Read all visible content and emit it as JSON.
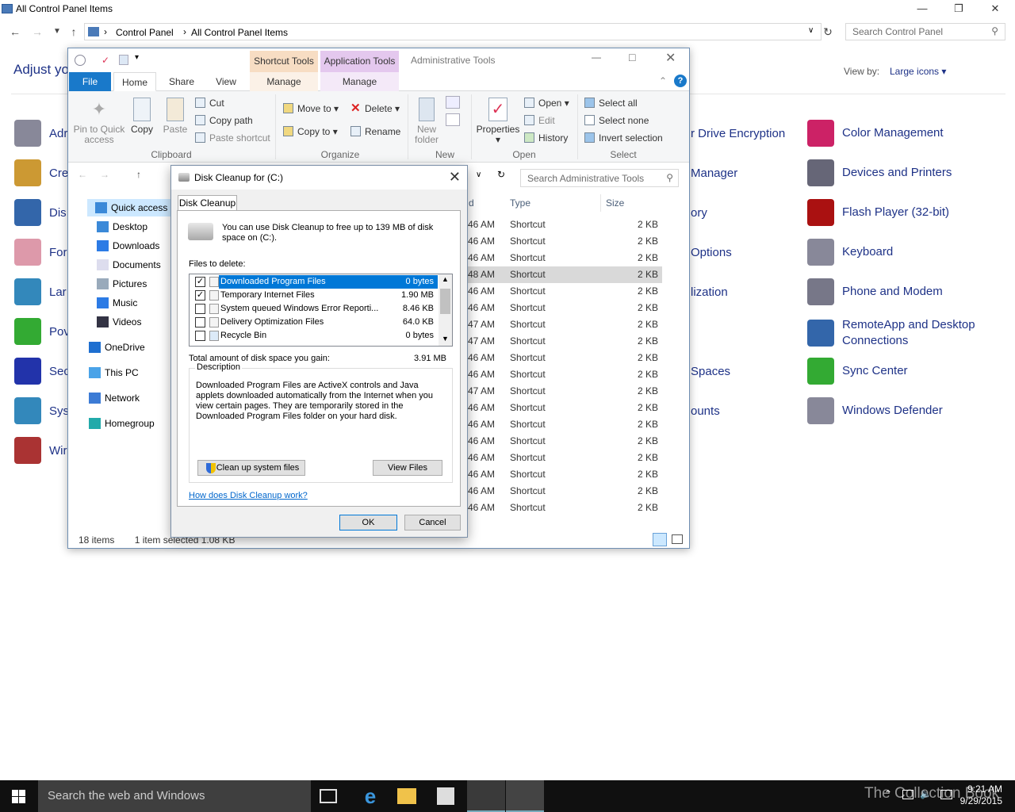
{
  "control_panel": {
    "title": "All Control Panel Items",
    "breadcrumb": [
      "Control Panel",
      "All Control Panel Items"
    ],
    "search_placeholder": "Search Control Panel",
    "heading": "Adjust yo",
    "view_by_label": "View by:",
    "view_by_value": "Large icons",
    "items_left": [
      "Adr",
      "Cre",
      "Dis",
      "For",
      "Lar",
      "Pov",
      "Sec",
      "Sys",
      "Wir"
    ],
    "items_middle": [
      "r Drive Encryption",
      "Manager",
      "ory",
      "Options",
      "lization",
      "Spaces",
      "ounts"
    ],
    "items_right": [
      {
        "label": "Color Management",
        "color": "#c26"
      },
      {
        "label": "Devices and Printers",
        "color": "#667"
      },
      {
        "label": "Flash Player (32-bit)",
        "color": "#a11"
      },
      {
        "label": "Keyboard",
        "color": "#889"
      },
      {
        "label": "Phone and Modem",
        "color": "#778"
      },
      {
        "label": "RemoteApp and Desktop Connections",
        "color": "#36a"
      },
      {
        "label": "Sync Center",
        "color": "#3a3"
      },
      {
        "label": "Windows Defender",
        "color": "#889"
      }
    ]
  },
  "explorer": {
    "context_tab_1": "Shortcut Tools",
    "context_tab_2": "Application Tools",
    "title": "Administrative Tools",
    "tabs": {
      "file": "File",
      "home": "Home",
      "share": "Share",
      "view": "View",
      "manage1": "Manage",
      "manage2": "Manage"
    },
    "ribbon": {
      "pin": "Pin to Quick access",
      "copy": "Copy",
      "paste": "Paste",
      "cut": "Cut",
      "copy_path": "Copy path",
      "paste_shortcut": "Paste shortcut",
      "clipboard": "Clipboard",
      "move_to": "Move to",
      "copy_to": "Copy to",
      "delete": "Delete",
      "rename": "Rename",
      "organize": "Organize",
      "new_folder": "New folder",
      "new": "New",
      "properties": "Properties",
      "open": "Open",
      "edit": "Edit",
      "history": "History",
      "open_group": "Open",
      "select_all": "Select all",
      "select_none": "Select none",
      "invert_selection": "Invert selection",
      "select_group": "Select"
    },
    "search_placeholder": "Search Administrative Tools",
    "nav": [
      "Quick access",
      "Desktop",
      "Downloads",
      "Documents",
      "Pictures",
      "Music",
      "Videos",
      "OneDrive",
      "This PC",
      "Network",
      "Homegroup"
    ],
    "columns": {
      "date_fragment": "d",
      "type": "Type",
      "size": "Size"
    },
    "rows": [
      {
        "d": "46 AM",
        "type": "Shortcut",
        "size": "2 KB"
      },
      {
        "d": "46 AM",
        "type": "Shortcut",
        "size": "2 KB"
      },
      {
        "d": "46 AM",
        "type": "Shortcut",
        "size": "2 KB"
      },
      {
        "d": "48 AM",
        "type": "Shortcut",
        "size": "2 KB"
      },
      {
        "d": "46 AM",
        "type": "Shortcut",
        "size": "2 KB"
      },
      {
        "d": "46 AM",
        "type": "Shortcut",
        "size": "2 KB"
      },
      {
        "d": "47 AM",
        "type": "Shortcut",
        "size": "2 KB"
      },
      {
        "d": "47 AM",
        "type": "Shortcut",
        "size": "2 KB"
      },
      {
        "d": "46 AM",
        "type": "Shortcut",
        "size": "2 KB"
      },
      {
        "d": "46 AM",
        "type": "Shortcut",
        "size": "2 KB"
      },
      {
        "d": "47 AM",
        "type": "Shortcut",
        "size": "2 KB"
      },
      {
        "d": "46 AM",
        "type": "Shortcut",
        "size": "2 KB"
      },
      {
        "d": "46 AM",
        "type": "Shortcut",
        "size": "2 KB"
      },
      {
        "d": "46 AM",
        "type": "Shortcut",
        "size": "2 KB"
      },
      {
        "d": "46 AM",
        "type": "Shortcut",
        "size": "2 KB"
      },
      {
        "d": "46 AM",
        "type": "Shortcut",
        "size": "2 KB"
      },
      {
        "d": "46 AM",
        "type": "Shortcut",
        "size": "2 KB"
      },
      {
        "d": "46 AM",
        "type": "Shortcut",
        "size": "2 KB"
      }
    ],
    "status_items": "18 items",
    "status_selected": "1 item selected  1.08 KB"
  },
  "dialog": {
    "title": "Disk Cleanup for  (C:)",
    "tab": "Disk Cleanup",
    "intro": "You can use Disk Cleanup to free up to 139 MB of disk space on  (C:).",
    "files_to_delete": "Files to delete:",
    "files": [
      {
        "checked": true,
        "name": "Downloaded Program Files",
        "size": "0 bytes"
      },
      {
        "checked": true,
        "name": "Temporary Internet Files",
        "size": "1.90 MB"
      },
      {
        "checked": false,
        "name": "System queued Windows Error Reporti...",
        "size": "8.46 KB"
      },
      {
        "checked": false,
        "name": "Delivery Optimization Files",
        "size": "64.0 KB"
      },
      {
        "checked": false,
        "name": "Recycle Bin",
        "size": "0 bytes"
      }
    ],
    "total_label": "Total amount of disk space you gain:",
    "total_value": "3.91 MB",
    "description_label": "Description",
    "description": "Downloaded Program Files are ActiveX controls and Java applets downloaded automatically from the Internet when you view certain pages. They are temporarily stored in the Downloaded Program Files folder on your hard disk.",
    "cleanup_button": "Clean up system files",
    "view_files_button": "View Files",
    "help_link": "How does Disk Cleanup work?",
    "ok": "OK",
    "cancel": "Cancel"
  },
  "taskbar": {
    "search_placeholder": "Search the web and Windows",
    "time": "9:21 AM",
    "date": "9/29/2015",
    "watermark": "The Collection Book"
  }
}
